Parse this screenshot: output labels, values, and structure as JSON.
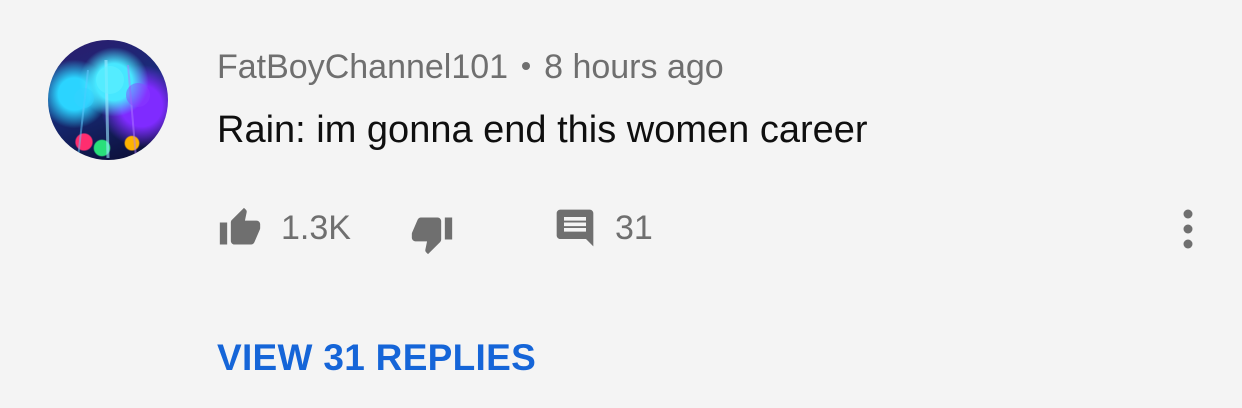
{
  "comment": {
    "author": "FatBoyChannel101",
    "timestamp": "8 hours ago",
    "text": "Rain: im gonna end this women career"
  },
  "actions": {
    "like_icon": "thumbs-up-icon",
    "like_count": "1.3K",
    "dislike_icon": "thumbs-down-icon",
    "reply_icon": "comment-icon",
    "reply_count": "31",
    "more_icon": "more-vertical-icon"
  },
  "replies": {
    "label": "VIEW 31 REPLIES"
  },
  "colors": {
    "background": "#f4f4f4",
    "secondary_text": "#6f6f6f",
    "primary_text": "#0f0f0f",
    "link": "#1565d8"
  }
}
